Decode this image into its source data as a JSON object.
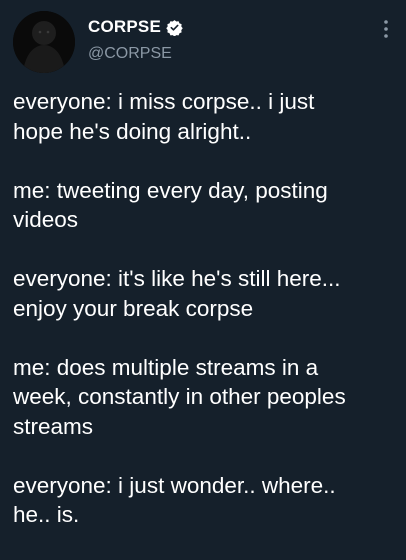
{
  "author": {
    "display_name": "CORPSE",
    "handle": "@CORPSE",
    "verified": true
  },
  "icons": {
    "verified": "verified-badge-icon",
    "more": "more-vertical-icon"
  },
  "colors": {
    "background": "#15202b",
    "text": "#ffffff",
    "secondary_text": "#8b98a5"
  },
  "tweet": {
    "paragraphs": [
      "everyone: i miss corpse.. i just\nhope he's doing alright..",
      "me: tweeting every day, posting\nvideos",
      "everyone: it's like he's still here...\nenjoy your break corpse",
      "me: does multiple streams in a\nweek, constantly in other peoples\nstreams",
      "everyone: i just wonder.. where..\nhe.. is."
    ]
  }
}
